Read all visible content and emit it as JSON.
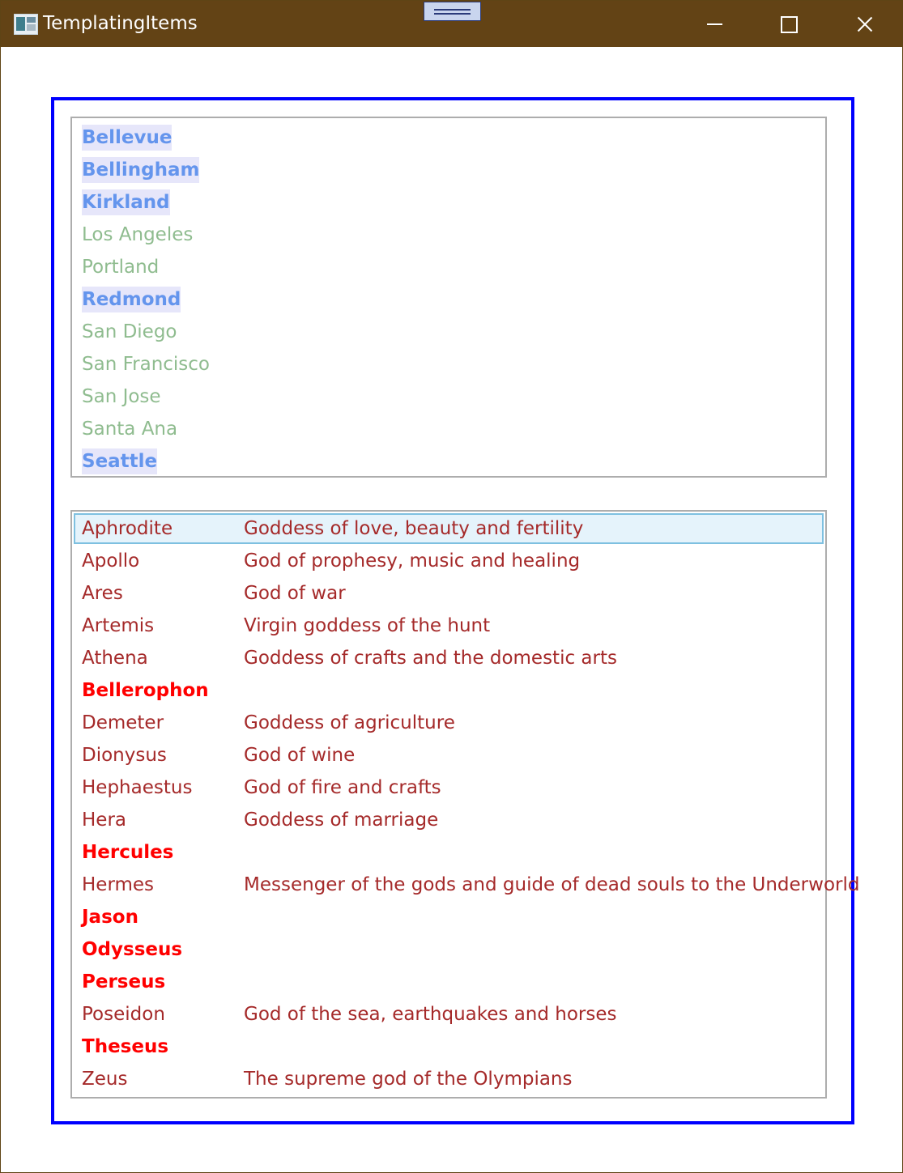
{
  "window": {
    "title": "TemplatingItems",
    "icon": "app-window-icon",
    "controls": [
      "minimize-icon",
      "maximize-icon",
      "close-icon"
    ]
  },
  "colors": {
    "titlebar": "#634315",
    "frame_border": "#0000ff",
    "city_highlight_text": "#6495ed",
    "city_highlight_bg": "#e6e6fa",
    "city_plain_text": "#8fbc8f",
    "god_text": "#a52a2a",
    "hero_text": "#ff0000",
    "selection_bg": "#e5f3fb",
    "selection_border": "#7ec0e0"
  },
  "cities": [
    {
      "name": "Bellevue",
      "highlighted": true
    },
    {
      "name": "Bellingham",
      "highlighted": true
    },
    {
      "name": "Kirkland",
      "highlighted": true
    },
    {
      "name": "Los Angeles",
      "highlighted": false
    },
    {
      "name": "Portland",
      "highlighted": false
    },
    {
      "name": "Redmond",
      "highlighted": true
    },
    {
      "name": "San Diego",
      "highlighted": false
    },
    {
      "name": "San Francisco",
      "highlighted": false
    },
    {
      "name": "San Jose",
      "highlighted": false
    },
    {
      "name": "Santa Ana",
      "highlighted": false
    },
    {
      "name": "Seattle",
      "highlighted": true
    }
  ],
  "gods": [
    {
      "name": "Aphrodite",
      "description": "Goddess of love, beauty and fertility",
      "selected": true
    },
    {
      "name": "Apollo",
      "description": "God of prophesy, music and healing"
    },
    {
      "name": "Ares",
      "description": "God of war"
    },
    {
      "name": "Artemis",
      "description": "Virgin goddess of the hunt"
    },
    {
      "name": "Athena",
      "description": "Goddess of crafts and the domestic arts"
    },
    {
      "name": "Bellerophon",
      "description": "",
      "hero": true
    },
    {
      "name": "Demeter",
      "description": "Goddess of agriculture"
    },
    {
      "name": "Dionysus",
      "description": "God of wine"
    },
    {
      "name": "Hephaestus",
      "description": "God of fire and crafts"
    },
    {
      "name": "Hera",
      "description": "Goddess of marriage"
    },
    {
      "name": "Hercules",
      "description": "",
      "hero": true
    },
    {
      "name": "Hermes",
      "description": "Messenger of the gods and guide of dead souls to the Underworld"
    },
    {
      "name": "Jason",
      "description": "",
      "hero": true
    },
    {
      "name": "Odysseus",
      "description": "",
      "hero": true
    },
    {
      "name": "Perseus",
      "description": "",
      "hero": true
    },
    {
      "name": "Poseidon",
      "description": "God of the sea, earthquakes and horses"
    },
    {
      "name": "Theseus",
      "description": "",
      "hero": true
    },
    {
      "name": "Zeus",
      "description": "The supreme god of the Olympians"
    }
  ]
}
